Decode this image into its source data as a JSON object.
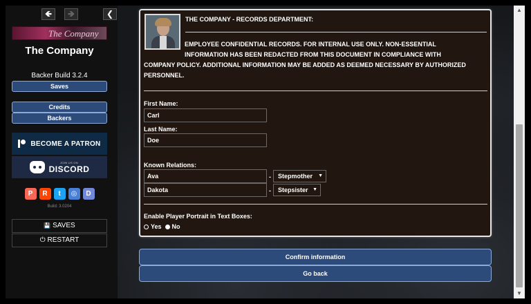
{
  "sidebar": {
    "back_glyph": "🡸",
    "forward_glyph": "🡺",
    "collapse_glyph": "❮",
    "banner_text": "The Company",
    "title": "The Company",
    "build": "Backer Build 3.2.4",
    "saves_label": "Saves",
    "credits_label": "Credits",
    "backers_label": "Backers",
    "patreon_label": "BECOME A PATRON",
    "discord_small": "JOIN US ON",
    "discord_label": "DISCORD",
    "socials": [
      {
        "name": "patreon",
        "glyph": "P",
        "color": "#f96854"
      },
      {
        "name": "reddit",
        "glyph": "R",
        "color": "#ff4500"
      },
      {
        "name": "twitter",
        "glyph": "t",
        "color": "#1da1f2"
      },
      {
        "name": "website",
        "glyph": "◎",
        "color": "#4a7fd6"
      },
      {
        "name": "discord",
        "glyph": "D",
        "color": "#7289da"
      }
    ],
    "build_small": "Build: 3.0204",
    "menu_saves": "SAVES",
    "menu_restart": "RESTART",
    "menu_saves_icon": "💾",
    "menu_restart_icon": "⏻"
  },
  "record": {
    "title": "THE COMPANY - RECORDS DEPARTMENT:",
    "line1": "EMPLOYEE CONFIDENTIAL RECORDS. FOR INTERNAL USE ONLY. NON-ESSENTIAL",
    "line2": "INFORMATION HAS BEEN REDACTED FROM THIS DOCUMENT IN COMPLIANCE WITH",
    "line3": "COMPANY POLICY. ADDITIONAL INFORMATION MAY BE ADDED AS DEEMED NECESSARY BY AUTHORIZED",
    "line4": "PERSONNEL.",
    "first_name_label": "First Name:",
    "first_name_value": "Carl",
    "last_name_label": "Last Name:",
    "last_name_value": "Doe",
    "relations_label": "Known Relations:",
    "relations": [
      {
        "name": "Ava",
        "relation": "Stepmother"
      },
      {
        "name": "Dakota",
        "relation": "Stepsister"
      }
    ],
    "relation_separator": "-",
    "portrait_label": "Enable Player Portrait in Text Boxes:",
    "yes_label": "Yes",
    "no_label": "No",
    "selected": "No"
  },
  "actions": {
    "confirm_label": "Confirm information",
    "back_label": "Go back"
  },
  "scrollbar": {
    "up_glyph": "▲",
    "down_glyph": "▼"
  }
}
